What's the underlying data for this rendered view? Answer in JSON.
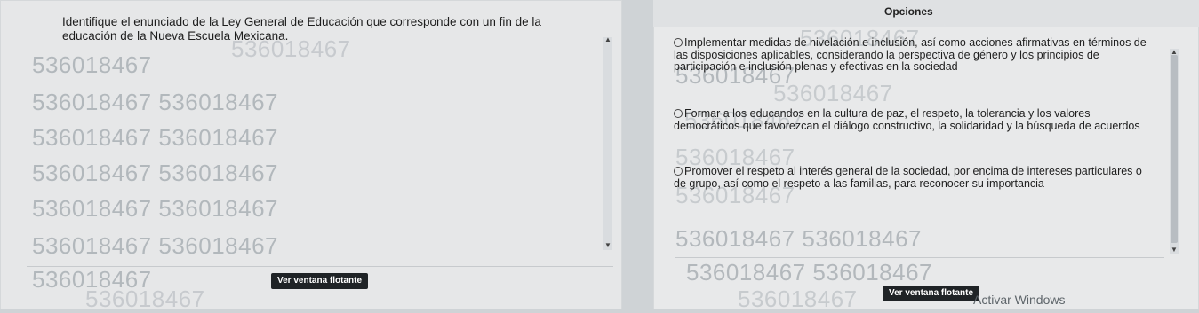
{
  "question": {
    "text": "Identifique el enunciado de la Ley General de Educación que corresponde con un fin de la educación de la Nueva Escuela Mexicana."
  },
  "watermark_text": "536018467",
  "options_panel": {
    "title": "Opciones",
    "items": [
      {
        "text": "Implementar medidas de nivelación e inclusión, así como acciones afirmativas en términos de las disposiciones aplicables, considerando la perspectiva de género y los principios de participación e inclusión plenas y efectivas en la sociedad"
      },
      {
        "text": "Formar a los educandos en la cultura de paz, el respeto, la tolerancia y los valores democráticos que favorezcan el diálogo constructivo, la solidaridad y la búsqueda de acuerdos"
      },
      {
        "text": "Promover el respeto al interés general de la sociedad, por encima de intereses particulares o de grupo, así como el respeto a las familias, para reconocer su importancia"
      }
    ]
  },
  "floating_button_label": "Ver ventana flotante",
  "windows_activation_text": "Activar Windows"
}
